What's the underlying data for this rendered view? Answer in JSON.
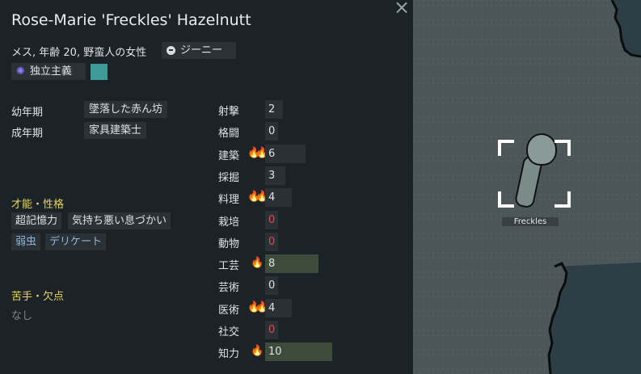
{
  "header": {
    "name": "Rose-Marie 'Freckles' Hazelnutt",
    "subtitle": "メス, 年齢 20, 野蛮人の女性",
    "faction": "ジーニー",
    "ideology": "独立主義",
    "ideology_color": "#3e9a97",
    "close_icon": "×"
  },
  "backstory": {
    "childhood_label": "幼年期",
    "childhood_value": "墜落した赤ん坊",
    "adulthood_label": "成年期",
    "adulthood_value": "家具建築士"
  },
  "traits": {
    "heading": "才能・性格",
    "items": [
      "超記憶力",
      "気持ち悪い息づかい",
      "弱虫",
      "デリケート"
    ]
  },
  "incapable": {
    "heading": "苦手・欠点",
    "none": "なし"
  },
  "skills": [
    {
      "name": "射撃",
      "value": "2",
      "level": 2,
      "passion": 0
    },
    {
      "name": "格闘",
      "value": "0",
      "level": 0,
      "passion": 0
    },
    {
      "name": "建築",
      "value": "6",
      "level": 6,
      "passion": 2
    },
    {
      "name": "採掘",
      "value": "3",
      "level": 3,
      "passion": 0
    },
    {
      "name": "料理",
      "value": "4",
      "level": 4,
      "passion": 2
    },
    {
      "name": "栽培",
      "value": "0",
      "level": 0,
      "passion": 0,
      "disabled": true
    },
    {
      "name": "動物",
      "value": "0",
      "level": 0,
      "passion": 0,
      "disabled": true
    },
    {
      "name": "工芸",
      "value": "8",
      "level": 8,
      "passion": 1
    },
    {
      "name": "芸術",
      "value": "0",
      "level": 0,
      "passion": 0
    },
    {
      "name": "医術",
      "value": "4",
      "level": 4,
      "passion": 2
    },
    {
      "name": "社交",
      "value": "0",
      "level": 0,
      "passion": 0,
      "disabled": true
    },
    {
      "name": "知力",
      "value": "10",
      "level": 10,
      "passion": 1
    }
  ],
  "map": {
    "pawn_label": "Freckles"
  },
  "colors": {
    "panel_bg": "#1b2329",
    "section_heading": "#e7d65a",
    "bar_high": "#3e4a3a",
    "zero_disabled": "#e04747"
  }
}
